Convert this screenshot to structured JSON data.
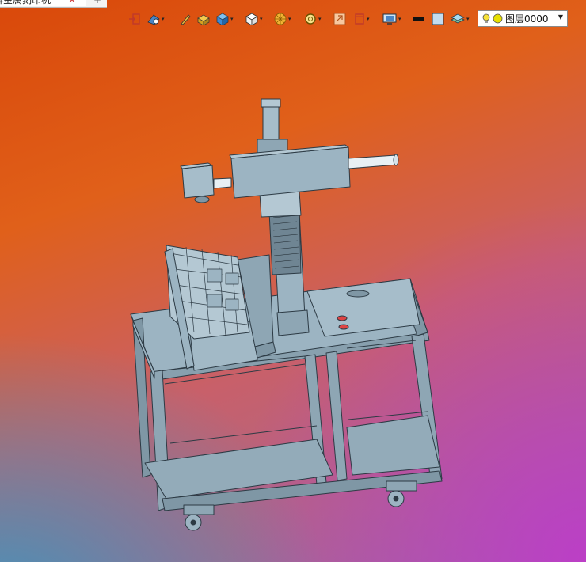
{
  "document_tab": {
    "title": "牌金属刻印机",
    "close_glyph": "✕",
    "new_tab_glyph": "+"
  },
  "toolbar": {
    "icons": [
      "exit-icon",
      "render-mode-icon",
      "pen-icon",
      "material-box-icon",
      "shaded-cube-icon",
      "wireframe-cube-icon",
      "color-wheel-icon",
      "zoom-icon",
      "import-icon",
      "view-icon",
      "monitor-icon",
      "line-color-icon",
      "fill-color-icon",
      "layers-icon"
    ]
  },
  "layer": {
    "selected": "图层0000",
    "colors": {
      "bulb": "#f7e23a",
      "dot": "#e8e000"
    }
  },
  "viewport": {
    "colors": {
      "top": "#d9480a",
      "left_bottom": "#3c96be",
      "right_bottom": "#be3cc8"
    }
  },
  "model": {
    "colors": {
      "frame": "#9cb4c2",
      "frame_dark": "#7f97a5",
      "outline": "#2c3a44",
      "rod": "#e8f0f4"
    }
  }
}
